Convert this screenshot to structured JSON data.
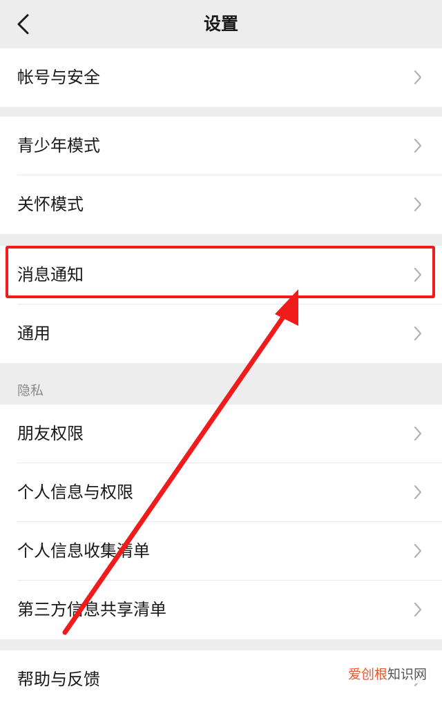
{
  "header": {
    "title": "设置"
  },
  "groups": [
    {
      "items": [
        {
          "label": "帐号与安全"
        }
      ]
    },
    {
      "items": [
        {
          "label": "青少年模式"
        },
        {
          "label": "关怀模式"
        }
      ]
    },
    {
      "items": [
        {
          "label": "消息通知"
        },
        {
          "label": "通用"
        }
      ]
    },
    {
      "caption": "隐私",
      "items": [
        {
          "label": "朋友权限"
        },
        {
          "label": "个人信息与权限"
        },
        {
          "label": "个人信息收集清单"
        },
        {
          "label": "第三方信息共享清单"
        }
      ]
    },
    {
      "items": [
        {
          "label": "帮助与反馈"
        }
      ]
    }
  ],
  "annotation": {
    "highlight_color": "#f01b1b",
    "highlighted_item": "消息通知"
  },
  "watermark": {
    "accent_text": "爱创根",
    "text": "知识网"
  },
  "colors": {
    "background": "#ededed",
    "card": "#ffffff",
    "text": "#191919",
    "caption": "#8a8a8a",
    "chevron": "#b2b2b2"
  }
}
